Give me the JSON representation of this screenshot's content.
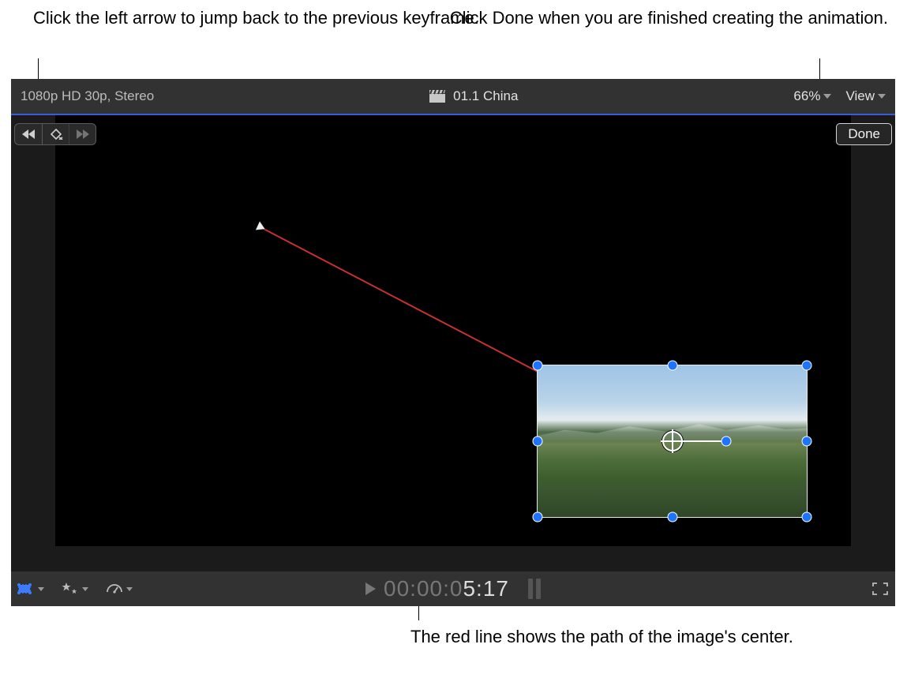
{
  "callouts": {
    "left": "Click the left arrow to jump back to the previous keyframe.",
    "right": "Click Done when you are finished creating the animation.",
    "bottom": "The red line shows the path of the image's center."
  },
  "header": {
    "format_info": "1080p HD 30p, Stereo",
    "clip_title": "01.1 China",
    "zoom_label": "66%",
    "view_label": "View"
  },
  "controls": {
    "done_label": "Done"
  },
  "timecode": {
    "dim": "00:00:0",
    "active": "5:17"
  }
}
